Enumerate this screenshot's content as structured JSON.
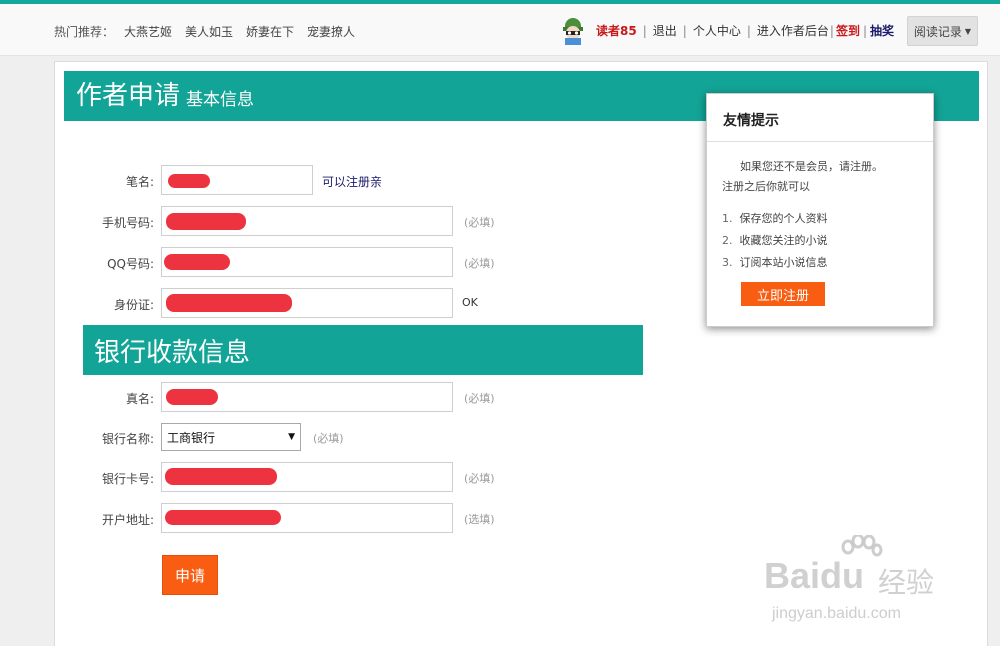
{
  "topbar": {
    "hot_label": "热门推荐：",
    "hot_links": [
      "大燕艺姬",
      "美人如玉",
      "娇妻在下",
      "宠妻撩人"
    ],
    "username": "读者85",
    "logout": "退出",
    "user_center": "个人中心",
    "author_backend": "进入作者后台",
    "checkin": "签到",
    "lottery": "抽奖",
    "history": "阅读记录",
    "separator": "|"
  },
  "header": {
    "title": "作者申请",
    "subtitle": "基本信息"
  },
  "basic_form": {
    "pen_name_label": "笔名:",
    "pen_name_hint": "可以注册亲",
    "phone_label": "手机号码:",
    "phone_hint": "(必填)",
    "qq_label": "QQ号码:",
    "qq_hint": "(必填)",
    "id_label": "身份证:",
    "id_hint": "OK"
  },
  "bank_section": {
    "title": "银行收款信息"
  },
  "bank_form": {
    "real_name_label": "真名:",
    "real_name_hint": "(必填)",
    "bank_name_label": "银行名称:",
    "bank_selected": "工商银行",
    "bank_hint": "(必填)",
    "card_label": "银行卡号:",
    "card_hint": "(必填)",
    "address_label": "开户地址:",
    "address_hint": "(选填)"
  },
  "submit_label": "申请",
  "tip": {
    "title": "友情提示",
    "text1": "如果您还不是会员，请注册。",
    "text2": "注册之后你就可以",
    "items": [
      "保存您的个人资料",
      "收藏您关注的小说",
      "订阅本站小说信息"
    ],
    "register_label": "立即注册"
  },
  "watermark": {
    "brand": "Baidu",
    "cn": "经验",
    "url": "jingyan.baidu.com"
  },
  "colors": {
    "accent": "#12a597",
    "button": "#f95d12",
    "redaction": "#ee3340",
    "username": "#c8191b"
  }
}
